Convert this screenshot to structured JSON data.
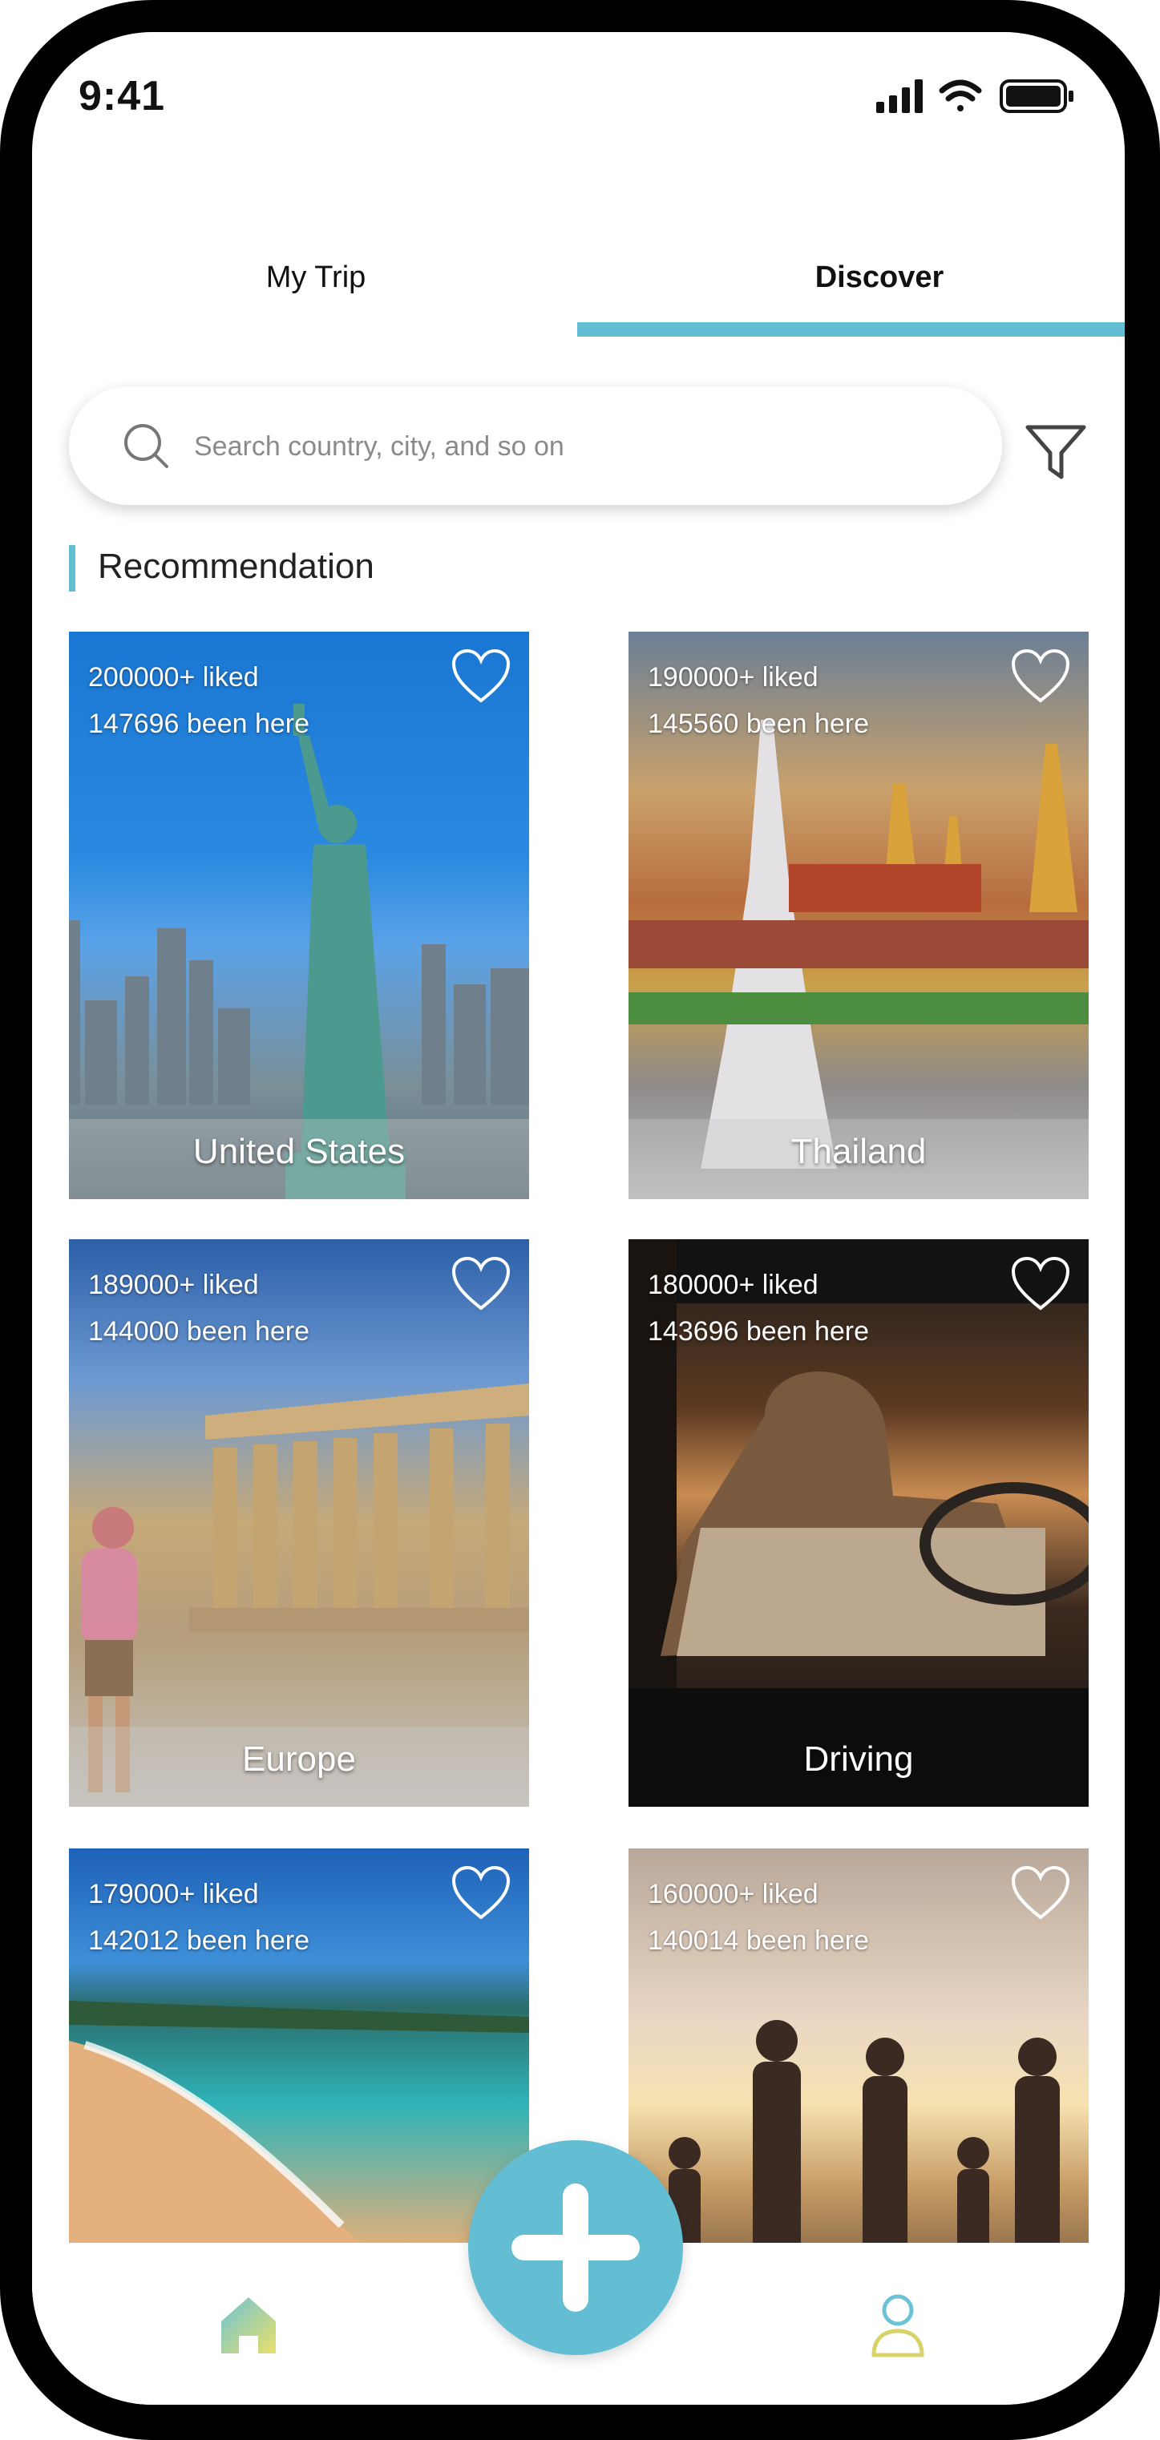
{
  "status_bar": {
    "time": "9:41"
  },
  "tabs": [
    {
      "label": "My Trip",
      "active": false
    },
    {
      "label": "Discover",
      "active": true
    }
  ],
  "search": {
    "placeholder": "Search country, city, and so on"
  },
  "section": {
    "title": "Recommendation"
  },
  "cards": [
    {
      "name": "United States",
      "liked": "200000+ liked",
      "visited": "147696 been here"
    },
    {
      "name": "Thailand",
      "liked": "190000+ liked",
      "visited": "145560 been here"
    },
    {
      "name": "Europe",
      "liked": "189000+ liked",
      "visited": "144000 been here"
    },
    {
      "name": "Driving",
      "liked": "180000+ liked",
      "visited": "143696 been here"
    },
    {
      "name": "",
      "liked": "179000+ liked",
      "visited": "142012 been here"
    },
    {
      "name": "",
      "liked": "160000+ liked",
      "visited": "140014 been here"
    }
  ],
  "icons": {
    "search": "search-icon",
    "filter": "filter-icon",
    "heart": "heart-outline-icon",
    "home": "home-icon",
    "add": "plus-icon",
    "profile": "user-icon"
  },
  "colors": {
    "accent": "#64bed3"
  }
}
